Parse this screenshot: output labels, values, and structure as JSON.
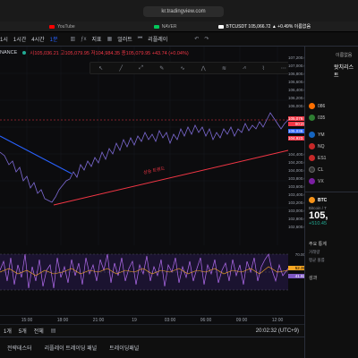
{
  "browser": {
    "url": "kr.tradingview.com",
    "tabs": [
      {
        "label": "YouTube",
        "color": "#ff0000"
      },
      {
        "label": "NAVER",
        "color": "#03c75a"
      },
      {
        "label": "BTCUSDT 105,066.72 ▲ +0.49% 이름없음",
        "color": "#ffffff"
      }
    ]
  },
  "toolbar": {
    "items": [
      "1시",
      "1시간",
      "4시간",
      "1분",
      "지표",
      "얼러트",
      "리플레이"
    ]
  },
  "symbol": {
    "exchange": "NANCE",
    "ohlc": "시105,036.21 고105,079.95 저104,984.35 종105,079.95 +43.74 (+0.04%)"
  },
  "price_axis": {
    "labels": [
      "107,200.00",
      "107,000.00",
      "106,800.00",
      "106,600.00",
      "106,400.00",
      "106,200.00",
      "106,000.00",
      "105,800.00",
      "105,600.00",
      "105,400.00",
      "105,200.00",
      "105,000.00",
      "104,800.00",
      "104,600.00",
      "104,400.00",
      "104,200.00",
      "104,000.00",
      "103,800.00",
      "103,600.00",
      "103,400.00",
      "103,200.00",
      "103,000.00",
      "102,800.00",
      "102,600.00",
      "102,400.00",
      "102,200.00"
    ],
    "current_price": "105,079.95",
    "current_countdown": "00:27",
    "other_price": "105,038.11",
    "other_price2": "104,923.12",
    "rsi_labels": [
      "70.00",
      "52.39",
      "41.92"
    ]
  },
  "annotation": "상승 트렌드",
  "time_axis": {
    "labels": [
      "15:00",
      "18:00",
      "21:00",
      "19",
      "03:00",
      "06:00",
      "09:00",
      "12:00"
    ],
    "clock": "20:02:32 (UTC+9)"
  },
  "bottom": {
    "ranges": [
      "1개",
      "5개",
      "전체"
    ]
  },
  "footer": {
    "tabs": [
      "전략테스터",
      "리플레이 트레이딩 패널",
      "트레이딩패널"
    ]
  },
  "watchlist": {
    "title": "왓치리스트",
    "items": [
      {
        "sym": "086",
        "color": "#ff6f00"
      },
      {
        "sym": "035",
        "color": "#2e7d32"
      },
      {
        "sym": "YM",
        "color": "#1565c0"
      },
      {
        "sym": "NQ",
        "color": "#c62828"
      },
      {
        "sym": "ES1",
        "color": "#c62828"
      },
      {
        "sym": "CL",
        "color": "#111111"
      },
      {
        "sym": "VX",
        "color": "#7b1fa2"
      }
    ],
    "btc_label": "BTC",
    "btc_name": "Bitcoin / T",
    "btc_price": "105,",
    "btc_change": "+510.45",
    "stat_label1": "주요 통계",
    "stat_label2": "거래량",
    "stat_label3": "평균 볼륨",
    "stat_label4": "성과"
  }
}
